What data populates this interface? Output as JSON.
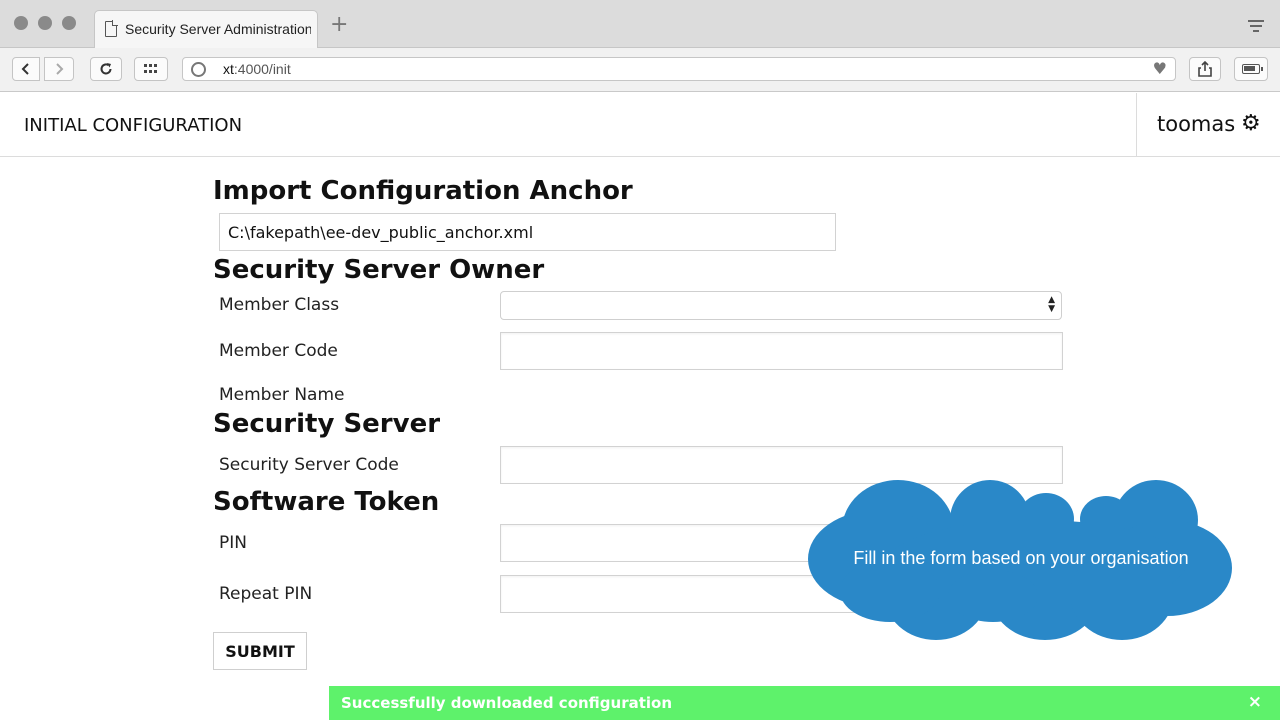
{
  "browser": {
    "tab_title": "Security Server Administration",
    "new_tab_symbol": "+",
    "url_host": "xt",
    "url_rest": ":4000/init",
    "icons": [
      "document-icon",
      "back-icon",
      "forward-icon",
      "reload-icon",
      "grid-icon",
      "globe-icon",
      "heart-icon",
      "share-icon",
      "battery-icon",
      "tab-menu-icon"
    ]
  },
  "header": {
    "title": "INITIAL CONFIGURATION",
    "username": "toomas",
    "gear_glyph": "⚙"
  },
  "form": {
    "anchor": {
      "heading": "Import Configuration Anchor",
      "file_value": "C:\\fakepath\\ee-dev_public_anchor.xml"
    },
    "owner": {
      "heading": "Security Server Owner",
      "member_class_label": "Member Class",
      "member_class_value": "",
      "member_code_label": "Member Code",
      "member_code_value": "",
      "member_name_label": "Member Name"
    },
    "server": {
      "heading": "Security Server",
      "server_code_label": "Security Server Code",
      "server_code_value": ""
    },
    "token": {
      "heading": "Software Token",
      "pin_label": "PIN",
      "repeat_pin_label": "Repeat PIN"
    },
    "submit_label": "SUBMIT"
  },
  "tooltip": {
    "text": "Fill in the form based on your organisation",
    "color": "#2a88c8"
  },
  "notification": {
    "text": "Successfully downloaded configuration",
    "close_symbol": "×",
    "color": "#5ef26b"
  }
}
